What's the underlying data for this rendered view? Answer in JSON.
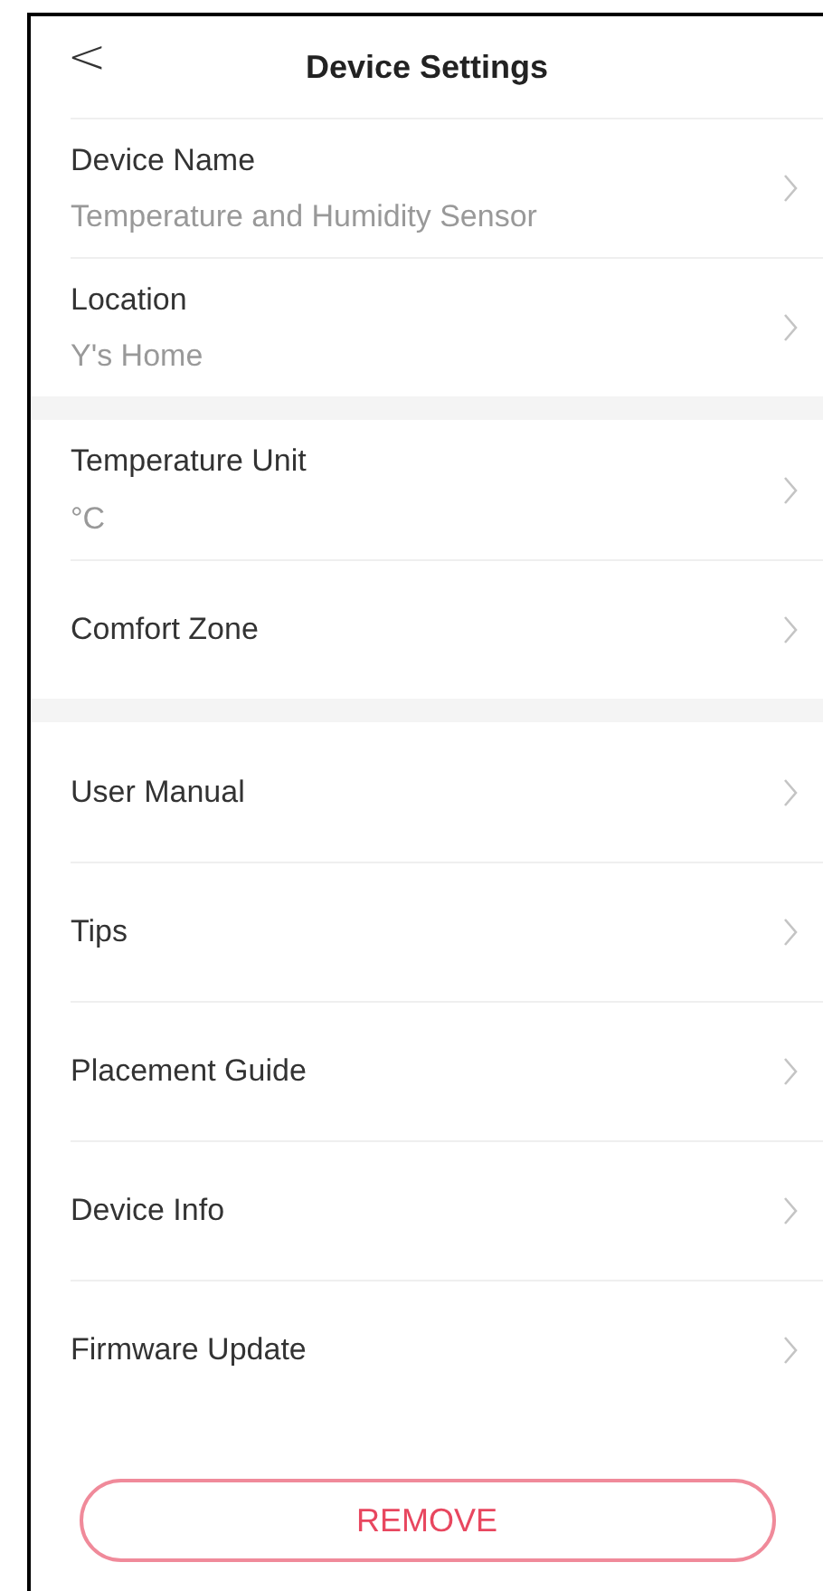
{
  "header": {
    "back": "<",
    "title": "Device Settings"
  },
  "sections": [
    {
      "items": [
        {
          "label": "Device Name",
          "value": "Temperature and Humidity Sensor"
        },
        {
          "label": "Location",
          "value": "Y's Home"
        }
      ]
    },
    {
      "items": [
        {
          "label": "Temperature Unit",
          "value": "°C"
        },
        {
          "label": "Comfort Zone"
        }
      ]
    },
    {
      "items": [
        {
          "label": "User Manual"
        },
        {
          "label": "Tips"
        },
        {
          "label": "Placement Guide"
        },
        {
          "label": "Device Info"
        },
        {
          "label": "Firmware Update"
        }
      ]
    }
  ],
  "remove_button": "REMOVE"
}
